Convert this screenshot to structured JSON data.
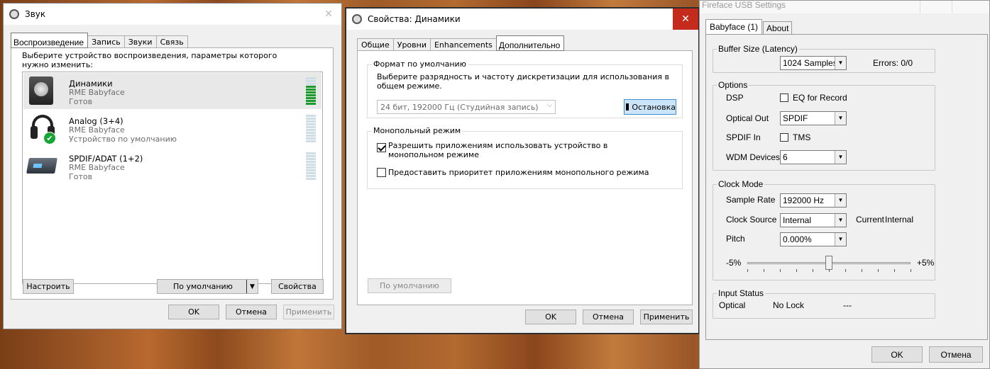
{
  "sound": {
    "title": "Звук",
    "close": "✕",
    "tabs": [
      "Воспроизведение",
      "Запись",
      "Звуки",
      "Связь"
    ],
    "description": "Выберите устройство воспроизведения, параметры которого нужно изменить:",
    "devices": [
      {
        "name": "Динамики",
        "driver": "RME Babyface",
        "status": "Готов",
        "level_bars": 7
      },
      {
        "name": "Analog (3+4)",
        "driver": "RME Babyface",
        "status": "Устройство по умолчанию",
        "level_bars": 0
      },
      {
        "name": "SPDIF/ADAT (1+2)",
        "driver": "RME Babyface",
        "status": "Готов",
        "level_bars": 0
      }
    ],
    "configure": "Настроить",
    "default": "По умолчанию",
    "properties": "Свойства",
    "ok": "OK",
    "cancel": "Отмена",
    "apply": "Применить"
  },
  "props": {
    "title": "Свойства: Динамики",
    "close": "✕",
    "tabs": [
      "Общие",
      "Уровни",
      "Enhancements",
      "Дополнительно"
    ],
    "format_group": "Формат по умолчанию",
    "format_desc": "Выберите разрядность и частоту дискретизации для использования в общем режиме.",
    "format_value": "24 бит, 192000 Гц (Студийная запись)",
    "stop": "Остановка",
    "exclusive_group": "Монопольный режим",
    "allow_exclusive": "Разрешить приложениям использовать устройство в монопольном режиме",
    "allow_exclusive_checked": true,
    "priority": "Предоставить приоритет приложениям монопольного режима",
    "priority_checked": false,
    "restore_default": "По умолчанию",
    "ok": "OK",
    "cancel": "Отмена",
    "apply": "Применить"
  },
  "fireface": {
    "title": "Fireface USB Settings",
    "tabs": [
      "Babyface (1)",
      "About"
    ],
    "buffer_group": "Buffer Size (Latency)",
    "buffer_value": "1024 Samples",
    "errors": "Errors: 0/0",
    "options_group": "Options",
    "dsp": "DSP",
    "eq_record": "EQ for Record",
    "optical_out": "Optical Out",
    "optical_out_value": "SPDIF",
    "spdif_in": "SPDIF In",
    "tms": "TMS",
    "wdm": "WDM Devices",
    "wdm_value": "6",
    "clock_group": "Clock Mode",
    "sample_rate": "Sample Rate",
    "sample_rate_value": "192000 Hz",
    "clock_source": "Clock Source",
    "clock_source_value": "Internal",
    "current": "Current",
    "current_value": "Internal",
    "pitch": "Pitch",
    "pitch_value": "0.000%",
    "minus": "-5%",
    "plus": "+5%",
    "pitch_position": 0.5,
    "input_group": "Input Status",
    "optical": "Optical",
    "no_lock": "No Lock",
    "dash": "---",
    "ok": "OK",
    "cancel": "Отмена"
  }
}
